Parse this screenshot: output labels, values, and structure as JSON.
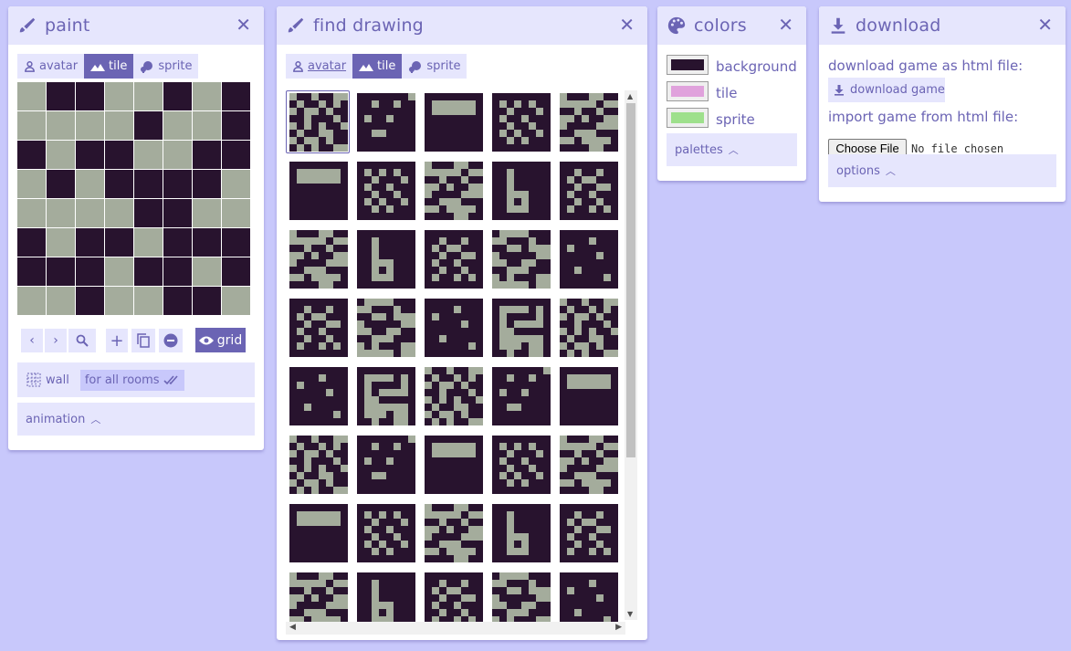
{
  "colors": {
    "bg": "#c8c8fb",
    "accent": "#6b64b4",
    "light": "#e6e6fd",
    "dark": "#28132e",
    "gray": "#a4ac9c",
    "tile_color": "#e0a2dc",
    "sprite_color": "#9ee08c"
  },
  "paint": {
    "title": "paint",
    "tabs": [
      {
        "label": "avatar",
        "icon": "avatar-icon"
      },
      {
        "label": "tile",
        "icon": "mountain-icon"
      },
      {
        "label": "sprite",
        "icon": "sprite-icon"
      }
    ],
    "active_tab": "tile",
    "grid": [
      "01100101",
      "00001001",
      "10110011",
      "01011110",
      "00001100",
      "10110111",
      "11101101",
      "00100110"
    ],
    "tools": {
      "prev": "prev-icon",
      "next": "next-icon",
      "find": "search-icon",
      "add": "plus-icon",
      "copy": "copy-icon",
      "delete": "minus-circle-icon",
      "grid_label": "grid"
    },
    "wall_label": "wall",
    "for_all_rooms_label": "for all rooms",
    "animation_label": "animation"
  },
  "find": {
    "title": "find drawing",
    "tabs": [
      {
        "label": "avatar"
      },
      {
        "label": "tile"
      },
      {
        "label": "sprite"
      }
    ],
    "active_tab": "tile",
    "thumbs": [
      [
        "01101100",
        "10110101",
        "01001011",
        "11011101",
        "01010110",
        "10110011",
        "01001011",
        "10101100"
      ],
      [
        "10000111",
        "00111011",
        "11001000",
        "01111100",
        "00110011",
        "11000111",
        "01011100",
        "00000100"
      ],
      [
        "01110011",
        "00000100",
        "11011011",
        "00101100",
        "01111000",
        "11000111",
        "00100001",
        "11110011"
      ],
      [
        "11111110",
        "11011011",
        "11111111",
        "10110111",
        "11111111",
        "11001111",
        "11111111",
        "11111111"
      ],
      [
        "11111111",
        "11110111",
        "10111111",
        "11111011",
        "11111111",
        "11011111",
        "11111101",
        "11111111"
      ],
      [
        "11111111",
        "11011111",
        "11011111",
        "11011111",
        "11000111",
        "11010111",
        "11000111",
        "11111111"
      ],
      [
        "11111111",
        "10000001",
        "10000001",
        "11111111",
        "11111111",
        "11111111",
        "11111111",
        "11111111"
      ],
      [
        "11111111",
        "10000101",
        "10111101",
        "10100001",
        "10011111",
        "10000001",
        "10001001",
        "11011001"
      ],
      [
        "11111111",
        "11011011",
        "10100111",
        "11011001",
        "10110111",
        "11011011",
        "10110101",
        "11111111"
      ],
      [
        "11111111",
        "10101011",
        "11011101",
        "10110111",
        "11011011",
        "10101101",
        "11010111",
        "11111111"
      ]
    ],
    "rows": 8
  },
  "colors_panel": {
    "title": "colors",
    "items": [
      {
        "label": "background"
      },
      {
        "label": "tile"
      },
      {
        "label": "sprite"
      }
    ],
    "palettes_label": "palettes"
  },
  "download": {
    "title": "download",
    "download_text": "download game as html file:",
    "download_button": "download game",
    "import_text": "import game from html file:",
    "choose_file": "Choose File",
    "no_file": "No file chosen",
    "options_label": "options"
  }
}
